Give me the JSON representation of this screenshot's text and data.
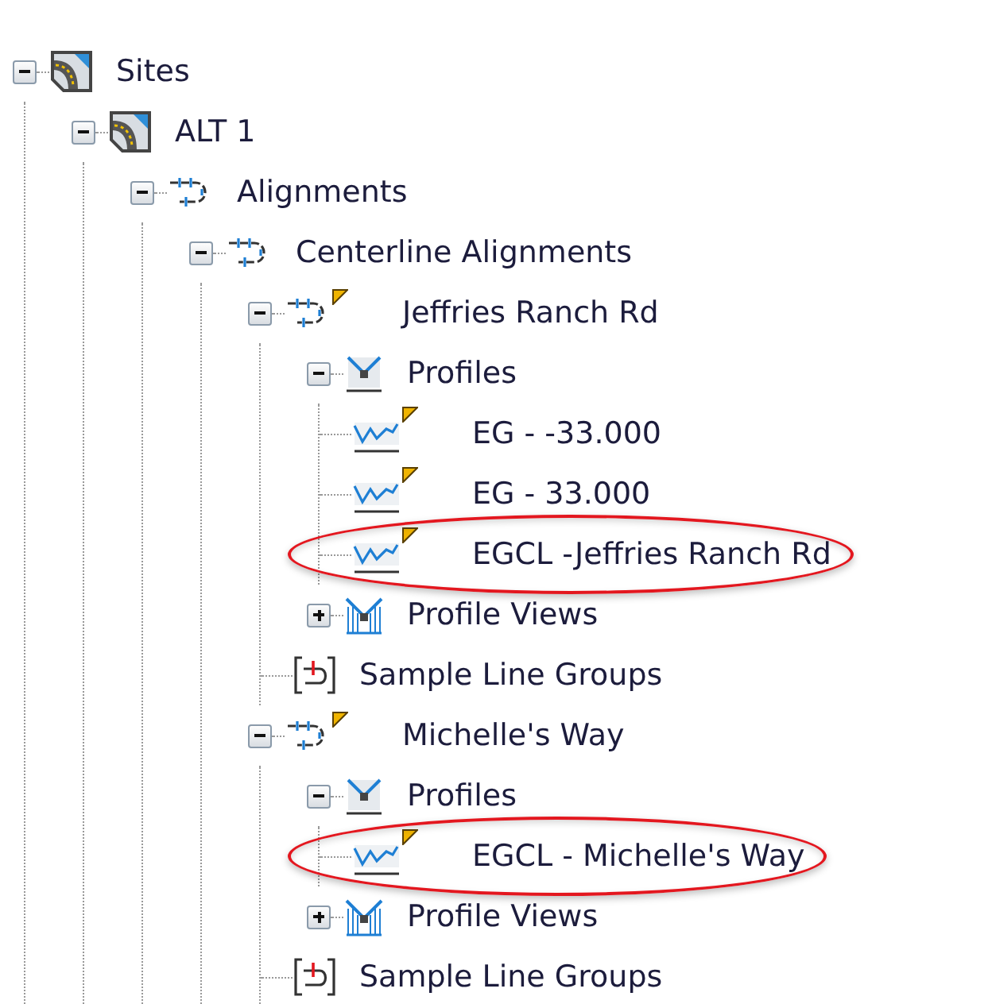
{
  "tree": [
    {
      "label": "Sites",
      "kind": "site",
      "expanded": true,
      "flagged": false,
      "circled": false,
      "children": [
        {
          "label": "ALT 1",
          "kind": "site",
          "expanded": true,
          "flagged": false,
          "circled": false,
          "children": [
            {
              "label": "Alignments",
              "kind": "alignment",
              "expanded": true,
              "flagged": false,
              "circled": false,
              "children": [
                {
                  "label": "Centerline Alignments",
                  "kind": "alignment",
                  "expanded": true,
                  "flagged": false,
                  "circled": false,
                  "children": [
                    {
                      "label": "Jeffries Ranch Rd",
                      "kind": "alignment",
                      "expanded": true,
                      "flagged": true,
                      "circled": false,
                      "children": [
                        {
                          "label": "Profiles",
                          "kind": "profiles",
                          "expanded": true,
                          "flagged": false,
                          "circled": false,
                          "children": [
                            {
                              "label": "EG - -33.000",
                              "kind": "profile",
                              "flagged": true,
                              "circled": false
                            },
                            {
                              "label": "EG - 33.000",
                              "kind": "profile",
                              "flagged": true,
                              "circled": false
                            },
                            {
                              "label": "EGCL -Jeffries Ranch Rd",
                              "kind": "profile",
                              "flagged": true,
                              "circled": true
                            }
                          ]
                        },
                        {
                          "label": "Profile Views",
                          "kind": "profile-views",
                          "expanded": false,
                          "flagged": false,
                          "circled": false
                        },
                        {
                          "label": "Sample Line Groups",
                          "kind": "sample-lines",
                          "flagged": false,
                          "circled": false
                        }
                      ]
                    },
                    {
                      "label": "Michelle's Way",
                      "kind": "alignment",
                      "expanded": true,
                      "flagged": true,
                      "circled": false,
                      "children": [
                        {
                          "label": "Profiles",
                          "kind": "profiles",
                          "expanded": true,
                          "flagged": false,
                          "circled": false,
                          "children": [
                            {
                              "label": "EGCL - Michelle's Way",
                              "kind": "profile",
                              "flagged": true,
                              "circled": true
                            }
                          ]
                        },
                        {
                          "label": "Profile Views",
                          "kind": "profile-views",
                          "expanded": false,
                          "flagged": false,
                          "circled": false
                        },
                        {
                          "label": "Sample Line Groups",
                          "kind": "sample-lines",
                          "flagged": false,
                          "circled": false
                        }
                      ]
                    }
                  ]
                }
              ]
            }
          ]
        }
      ]
    }
  ]
}
